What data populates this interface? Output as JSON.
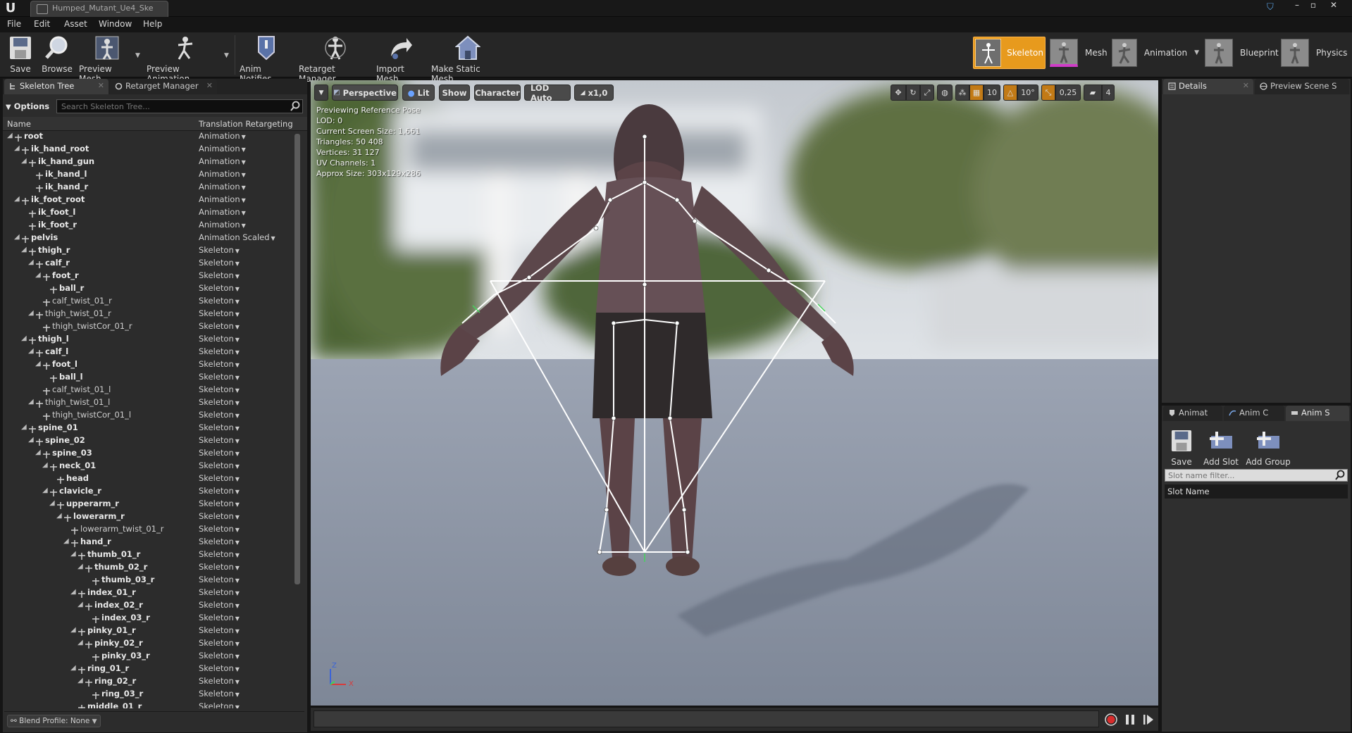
{
  "window": {
    "doc_tab": "Humped_Mutant_Ue4_Ske",
    "controls": [
      "–",
      "▫",
      "✕"
    ]
  },
  "menu": [
    "File",
    "Edit",
    "Asset",
    "Window",
    "Help"
  ],
  "toolbar": {
    "buttons": [
      {
        "label": "Save",
        "icon": "save-icon"
      },
      {
        "label": "Browse",
        "icon": "magnifier-icon"
      },
      {
        "label": "Preview Mesh",
        "icon": "mesh-icon"
      },
      {
        "label": "Preview Animation",
        "icon": "animation-icon"
      },
      {
        "label": "Anim Notifies",
        "icon": "notify-icon"
      },
      {
        "label": "Retarget Manager",
        "icon": "retarget-icon"
      },
      {
        "label": "Import Mesh",
        "icon": "import-icon"
      },
      {
        "label": "Make Static Mesh",
        "icon": "house-icon"
      }
    ]
  },
  "modes": [
    {
      "label": "Skeleton",
      "active": true
    },
    {
      "label": "Mesh",
      "active": false
    },
    {
      "label": "Animation",
      "active": false
    },
    {
      "label": "Blueprint",
      "active": false
    },
    {
      "label": "Physics",
      "active": false
    }
  ],
  "left_panel": {
    "tabs": [
      "Skeleton Tree",
      "Retarget Manager"
    ],
    "options_label": "Options",
    "search_placeholder": "Search Skeleton Tree...",
    "col_name": "Name",
    "col_retarget": "Translation Retargeting",
    "footer": "Blend Profile: None",
    "bones": [
      {
        "name": "root",
        "d": 0,
        "mode": "Animation"
      },
      {
        "name": "ik_hand_root",
        "d": 1,
        "mode": "Animation"
      },
      {
        "name": "ik_hand_gun",
        "d": 2,
        "mode": "Animation"
      },
      {
        "name": "ik_hand_l",
        "d": 3,
        "mode": "Animation"
      },
      {
        "name": "ik_hand_r",
        "d": 3,
        "mode": "Animation"
      },
      {
        "name": "ik_foot_root",
        "d": 1,
        "mode": "Animation"
      },
      {
        "name": "ik_foot_l",
        "d": 2,
        "mode": "Animation"
      },
      {
        "name": "ik_foot_r",
        "d": 2,
        "mode": "Animation"
      },
      {
        "name": "pelvis",
        "d": 1,
        "mode": "Animation Scaled"
      },
      {
        "name": "thigh_r",
        "d": 2,
        "mode": "Skeleton"
      },
      {
        "name": "calf_r",
        "d": 3,
        "mode": "Skeleton"
      },
      {
        "name": "foot_r",
        "d": 4,
        "mode": "Skeleton"
      },
      {
        "name": "ball_r",
        "d": 5,
        "mode": "Skeleton"
      },
      {
        "name": "calf_twist_01_r",
        "d": 4,
        "mode": "Skeleton",
        "light": true
      },
      {
        "name": "thigh_twist_01_r",
        "d": 3,
        "mode": "Skeleton",
        "light": true
      },
      {
        "name": "thigh_twistCor_01_r",
        "d": 4,
        "mode": "Skeleton",
        "light": true
      },
      {
        "name": "thigh_l",
        "d": 2,
        "mode": "Skeleton"
      },
      {
        "name": "calf_l",
        "d": 3,
        "mode": "Skeleton"
      },
      {
        "name": "foot_l",
        "d": 4,
        "mode": "Skeleton"
      },
      {
        "name": "ball_l",
        "d": 5,
        "mode": "Skeleton"
      },
      {
        "name": "calf_twist_01_l",
        "d": 4,
        "mode": "Skeleton",
        "light": true
      },
      {
        "name": "thigh_twist_01_l",
        "d": 3,
        "mode": "Skeleton",
        "light": true
      },
      {
        "name": "thigh_twistCor_01_l",
        "d": 4,
        "mode": "Skeleton",
        "light": true
      },
      {
        "name": "spine_01",
        "d": 2,
        "mode": "Skeleton"
      },
      {
        "name": "spine_02",
        "d": 3,
        "mode": "Skeleton"
      },
      {
        "name": "spine_03",
        "d": 4,
        "mode": "Skeleton"
      },
      {
        "name": "neck_01",
        "d": 5,
        "mode": "Skeleton"
      },
      {
        "name": "head",
        "d": 6,
        "mode": "Skeleton"
      },
      {
        "name": "clavicle_r",
        "d": 5,
        "mode": "Skeleton"
      },
      {
        "name": "upperarm_r",
        "d": 6,
        "mode": "Skeleton"
      },
      {
        "name": "lowerarm_r",
        "d": 7,
        "mode": "Skeleton"
      },
      {
        "name": "lowerarm_twist_01_r",
        "d": 8,
        "mode": "Skeleton",
        "light": true
      },
      {
        "name": "hand_r",
        "d": 8,
        "mode": "Skeleton"
      },
      {
        "name": "thumb_01_r",
        "d": 9,
        "mode": "Skeleton"
      },
      {
        "name": "thumb_02_r",
        "d": 10,
        "mode": "Skeleton"
      },
      {
        "name": "thumb_03_r",
        "d": 11,
        "mode": "Skeleton"
      },
      {
        "name": "index_01_r",
        "d": 9,
        "mode": "Skeleton"
      },
      {
        "name": "index_02_r",
        "d": 10,
        "mode": "Skeleton"
      },
      {
        "name": "index_03_r",
        "d": 11,
        "mode": "Skeleton"
      },
      {
        "name": "pinky_01_r",
        "d": 9,
        "mode": "Skeleton"
      },
      {
        "name": "pinky_02_r",
        "d": 10,
        "mode": "Skeleton"
      },
      {
        "name": "pinky_03_r",
        "d": 11,
        "mode": "Skeleton"
      },
      {
        "name": "ring_01_r",
        "d": 9,
        "mode": "Skeleton"
      },
      {
        "name": "ring_02_r",
        "d": 10,
        "mode": "Skeleton"
      },
      {
        "name": "ring_03_r",
        "d": 11,
        "mode": "Skeleton"
      },
      {
        "name": "middle_01_r",
        "d": 9,
        "mode": "Skeleton"
      }
    ]
  },
  "viewport": {
    "buttons": {
      "perspective": "Perspective",
      "lit": "Lit",
      "show": "Show",
      "character": "Character",
      "lod": "LOD Auto",
      "speed": "x1,0"
    },
    "snap": {
      "grid": "10",
      "angle": "10°",
      "scale": "0,25",
      "camera_speed": "4"
    },
    "stats": [
      "Previewing Reference Pose",
      "LOD: 0",
      "Current Screen Size: 1,661",
      "Triangles: 50 408",
      "Vertices: 31 127",
      "UV Channels: 1",
      "Approx Size: 303x129x286"
    ],
    "axis": {
      "z": "Z",
      "x": "X"
    }
  },
  "right_panel": {
    "top_tabs": [
      "Details",
      "Preview Scene S"
    ],
    "bottom_tabs": [
      "Animat",
      "Anim C",
      "Anim S"
    ],
    "slot_buttons": [
      "Save",
      "Add Slot",
      "Add Group"
    ],
    "slot_filter_placeholder": "Slot name filter...",
    "slot_header": "Slot Name"
  },
  "colors": {
    "accent": "#e79a1d",
    "panel": "#232323",
    "viewport_sky": "#9aa3b2"
  }
}
